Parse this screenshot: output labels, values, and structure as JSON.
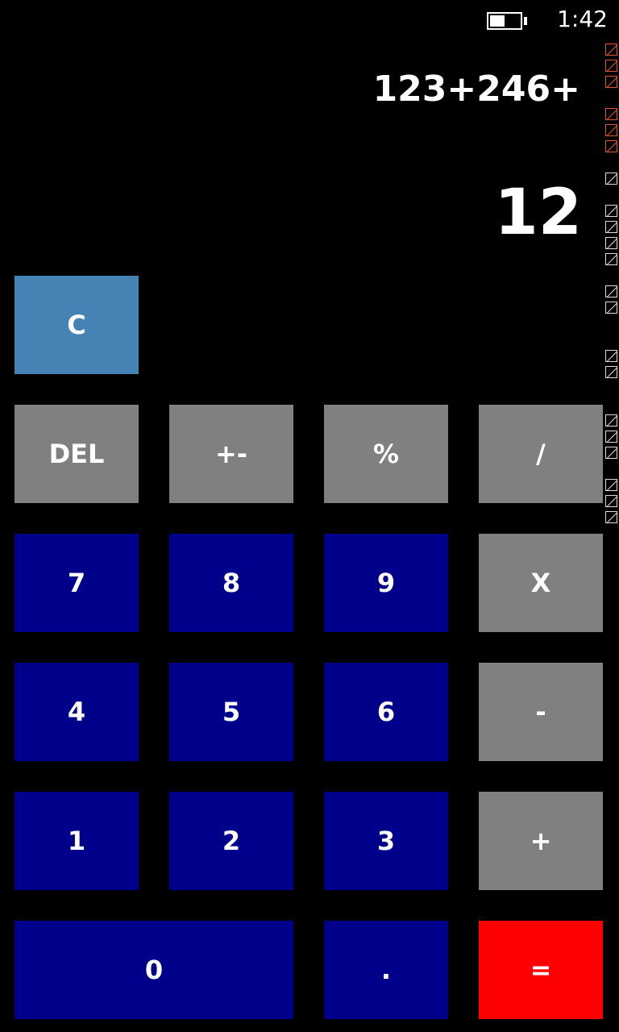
{
  "status": {
    "time": "1:42",
    "battery_level": 0.5
  },
  "display": {
    "expression": "123+246+",
    "result": "12"
  },
  "keys": {
    "clear": "C",
    "del": "DEL",
    "plus_minus": "+-",
    "percent": "%",
    "divide": "/",
    "seven": "7",
    "eight": "8",
    "nine": "9",
    "multiply": "X",
    "four": "4",
    "five": "5",
    "six": "6",
    "subtract": "-",
    "one": "1",
    "two": "2",
    "three": "3",
    "add": "+",
    "zero": "0",
    "decimal": ".",
    "equals": "="
  },
  "colors": {
    "clear": "#4682b4",
    "function": "#808080",
    "number": "#00008b",
    "equals": "#ff0000",
    "background": "#000000",
    "text": "#ffffff"
  }
}
